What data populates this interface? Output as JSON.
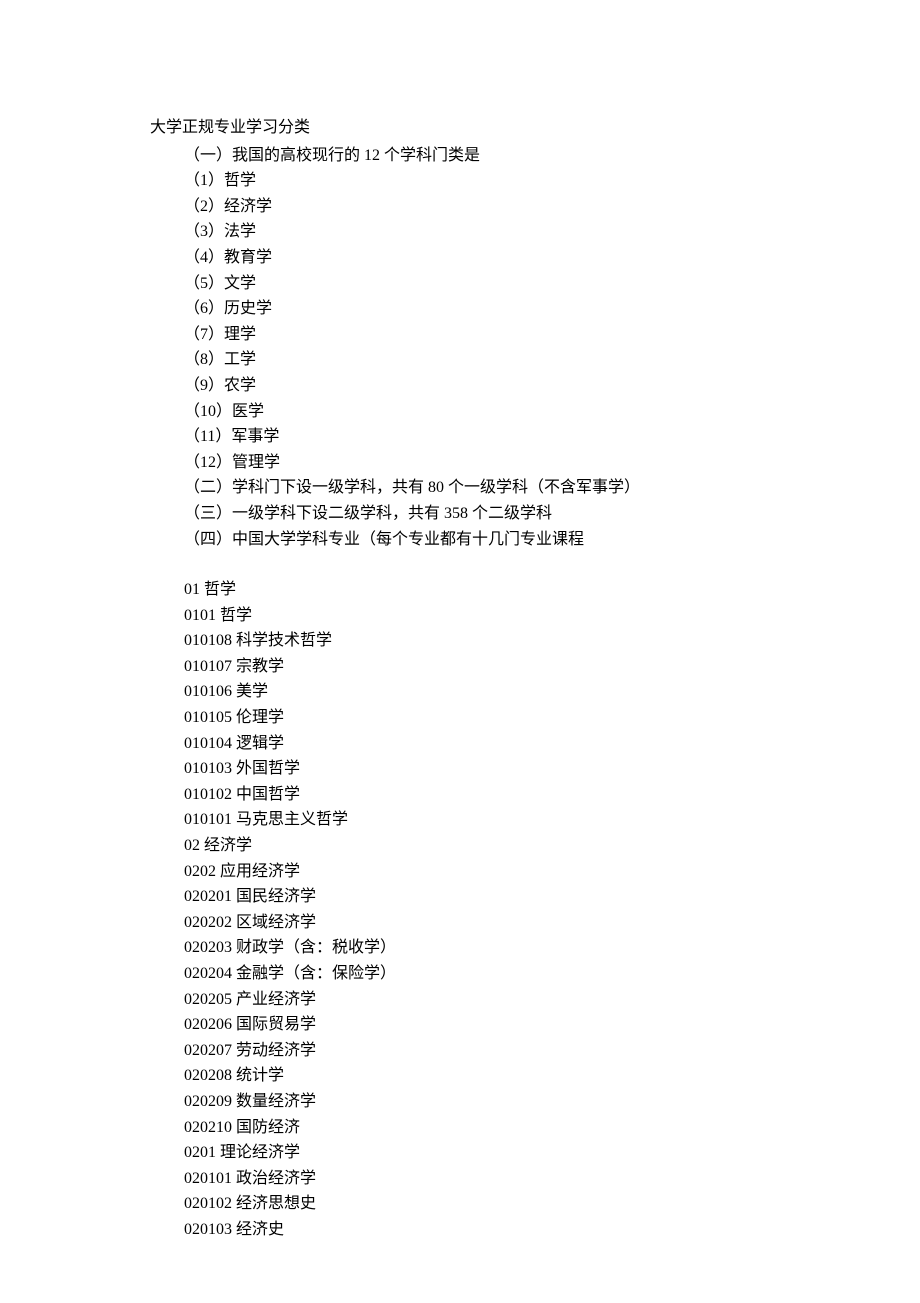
{
  "title": "大学正规专业学习分类",
  "section1": {
    "header": "（一）我国的高校现行的 12 个学科门类是",
    "items": [
      "（1）哲学",
      "（2）经济学",
      "（3）法学",
      "（4）教育学",
      "（5）文学",
      "（6）历史学",
      "（7）理学",
      "（8）工学",
      "（9）农学",
      "（10）医学",
      "（11）军事学",
      "（12）管理学"
    ]
  },
  "section2": "（二）学科门下设一级学科，共有 80 个一级学科（不含军事学）",
  "section3": "（三）一级学科下设二级学科，共有 358 个二级学科",
  "section4": "（四）中国大学学科专业（每个专业都有十几门专业课程",
  "codes": [
    "01 哲学",
    "0101  哲学",
    "010108  科学技术哲学",
    "010107  宗教学",
    "010106  美学",
    "010105  伦理学",
    "010104  逻辑学",
    "010103  外国哲学",
    "010102  中国哲学",
    "010101  马克思主义哲学",
    "02  经济学",
    "0202  应用经济学",
    "020201  国民经济学",
    "020202  区域经济学",
    "020203  财政学（含：税收学）",
    "020204  金融学（含：保险学）",
    "020205  产业经济学",
    "020206  国际贸易学",
    "020207  劳动经济学",
    "020208  统计学",
    "020209  数量经济学",
    "020210  国防经济",
    "0201  理论经济学",
    "020101  政治经济学",
    "020102  经济思想史",
    "020103  经济史"
  ]
}
